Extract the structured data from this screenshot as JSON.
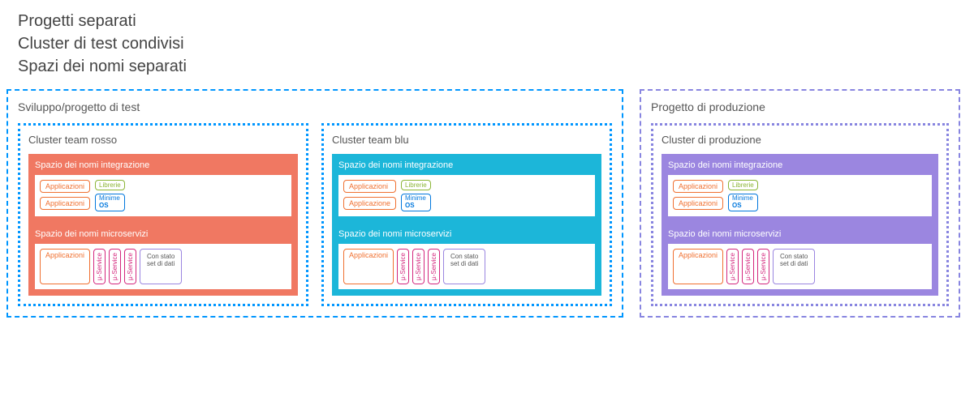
{
  "headings": {
    "h1": "Progetti separati",
    "h2": "Cluster di test condivisi",
    "h3": "Spazi dei nomi separati"
  },
  "dev_project": {
    "title": "Sviluppo/progetto di test",
    "clusters": {
      "red": {
        "title": "Cluster team rosso"
      },
      "blue": {
        "title": "Cluster team blu"
      }
    }
  },
  "prod_project": {
    "title": "Progetto di produzione",
    "cluster": {
      "title": "Cluster di produzione"
    }
  },
  "ns": {
    "integration": "Spazio dei nomi integrazione",
    "microservices": "Spazio dei nomi microservizi"
  },
  "labels": {
    "app1": "Applicazioni",
    "app2": "Applicazioni",
    "app_alt": "Applicazione",
    "lib": "Librerie",
    "minos_line1": "Minime",
    "minos_line2": "OS",
    "svc": "µ-Service",
    "stateful_line1": "Con stato",
    "stateful_line2": "set di dati"
  }
}
